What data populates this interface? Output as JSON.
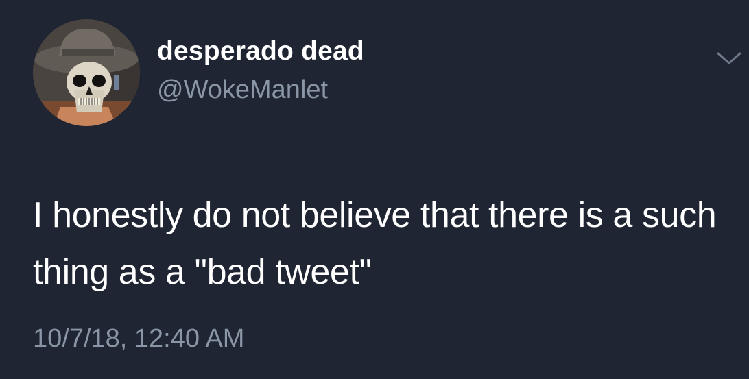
{
  "tweet": {
    "user": {
      "display_name": "desperado dead",
      "handle": "@WokeManlet",
      "avatar_icon": "skeleton-cowboy-avatar"
    },
    "menu_icon": "chevron-down-icon",
    "text": "I honestly do not believe that there is a such thing as a \"bad tweet\"",
    "timestamp": "10/7/18, 12:40 AM"
  },
  "colors": {
    "background": "#1f2532",
    "primary_text": "#ffffff",
    "secondary_text": "#8a96a6"
  }
}
